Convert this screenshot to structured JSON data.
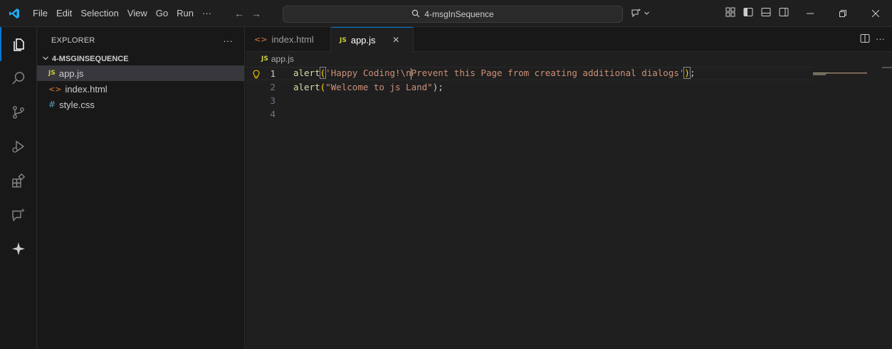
{
  "menu": [
    "File",
    "Edit",
    "Selection",
    "View",
    "Go",
    "Run",
    "···"
  ],
  "search": {
    "text": "4-msgInSequence"
  },
  "explorer": {
    "title": "EXPLORER",
    "dots": "···",
    "folder": "4-MSGINSEQUENCE",
    "files": [
      {
        "icon": "JS",
        "name": "app.js"
      },
      {
        "icon": "<>",
        "name": "index.html"
      },
      {
        "icon": "#",
        "name": "style.css"
      }
    ]
  },
  "tabs": [
    {
      "icon": "<>",
      "label": "index.html"
    },
    {
      "icon": "JS",
      "label": "app.js",
      "close": "×"
    }
  ],
  "tab_actions": {
    "more": "···"
  },
  "breadcrumb": {
    "icon": "JS",
    "file": "app.js"
  },
  "code": {
    "line_numbers": [
      "1",
      "2",
      "3",
      "4"
    ],
    "line1": {
      "fn": "alert",
      "open": "(",
      "str_a": "'Happy Coding!\\",
      "esc": "n",
      "str_b": "Prevent this Page from creating additional dialogs'",
      "close": ")",
      "semi": ";"
    },
    "line2": {
      "fn": "alert",
      "open": "(",
      "str": "\"Welcome to js Land\"",
      "close": ");"
    }
  },
  "colors": {
    "accent": "#0078d4",
    "editor_bg": "#1f1f1f",
    "sidebar_bg": "#181818",
    "selection": "#37373d",
    "js_icon": "#cbcb41",
    "html_icon": "#e37933",
    "css_icon": "#519aba"
  }
}
